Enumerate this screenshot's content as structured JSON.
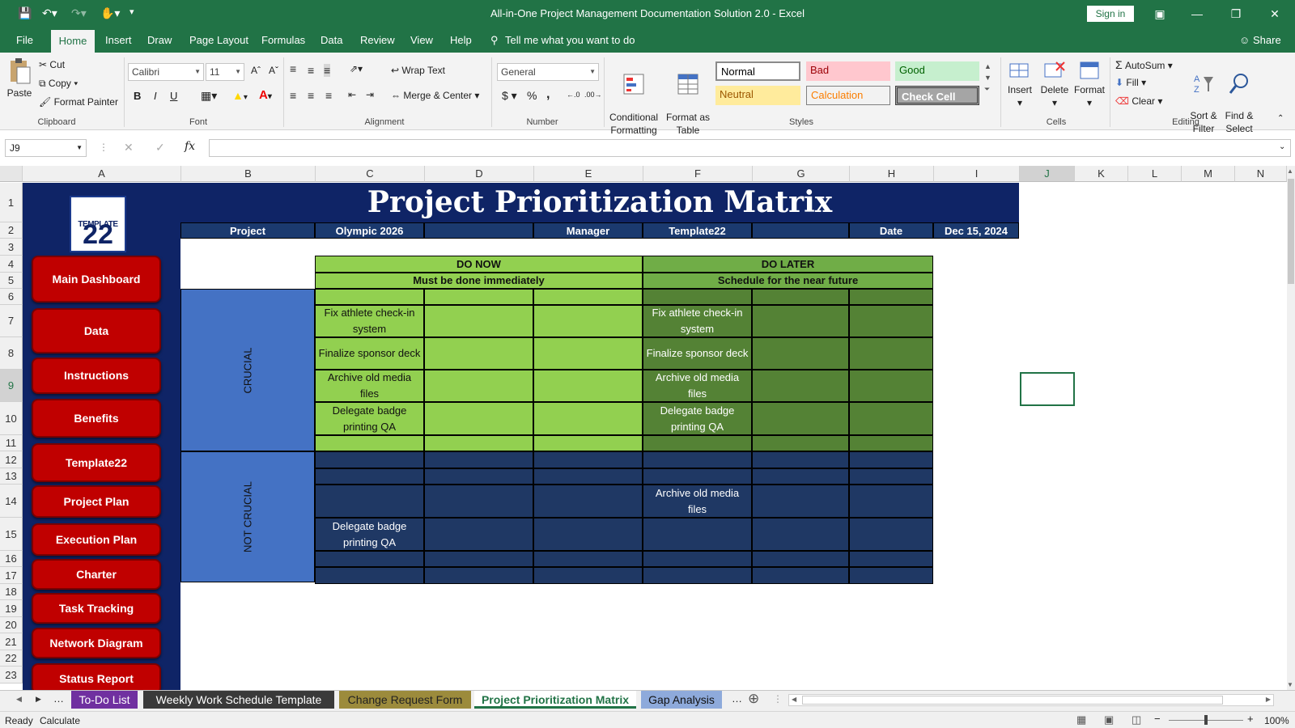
{
  "window": {
    "title": "All-in-One Project Management Documentation Solution 2.0  -  Excel",
    "sign_in": "Sign in",
    "share": "Share"
  },
  "ribbon_tabs": [
    "File",
    "Home",
    "Insert",
    "Draw",
    "Page Layout",
    "Formulas",
    "Data",
    "Review",
    "View",
    "Help"
  ],
  "tell_me": "Tell me what you want to do",
  "clipboard": {
    "paste": "Paste",
    "cut": "Cut",
    "copy": "Copy",
    "format_painter": "Format Painter",
    "label": "Clipboard"
  },
  "font": {
    "name": "Calibri",
    "size": "11",
    "label": "Font",
    "bold": "B",
    "italic": "I",
    "underline": "U"
  },
  "alignment": {
    "wrap_text": "Wrap Text",
    "merge_center": "Merge & Center",
    "label": "Alignment"
  },
  "number": {
    "format": "General",
    "label": "Number",
    "currency": "$",
    "percent": "%",
    "comma": ","
  },
  "styles": {
    "conditional": "Conditional\nFormatting",
    "format_table": "Format as\nTable",
    "label": "Styles",
    "cells": [
      {
        "name": "Normal",
        "bg": "#ffffff",
        "fg": "#000000"
      },
      {
        "name": "Bad",
        "bg": "#ffc7ce",
        "fg": "#9c0006"
      },
      {
        "name": "Good",
        "bg": "#c6efce",
        "fg": "#006100"
      },
      {
        "name": "Neutral",
        "bg": "#ffeb9c",
        "fg": "#9c5700"
      },
      {
        "name": "Calculation",
        "bg": "#f2f2f2",
        "fg": "#fa7d00"
      },
      {
        "name": "Check Cell",
        "bg": "#a5a5a5",
        "fg": "#ffffff"
      }
    ]
  },
  "cells": {
    "insert": "Insert",
    "delete": "Delete",
    "format": "Format",
    "label": "Cells"
  },
  "editing": {
    "autosum": "AutoSum",
    "fill": "Fill",
    "clear": "Clear",
    "sort": "Sort &\nFilter",
    "find": "Find &\nSelect",
    "label": "Editing"
  },
  "namebox": "J9",
  "columns": [
    "A",
    "B",
    "C",
    "D",
    "E",
    "F",
    "G",
    "H",
    "I",
    "J",
    "K",
    "L",
    "M",
    "N"
  ],
  "rows": [
    "1",
    "2",
    "3",
    "4",
    "5",
    "6",
    "7",
    "8",
    "9",
    "10",
    "11",
    "12",
    "13",
    "14",
    "15",
    "16",
    "17",
    "18",
    "19",
    "20",
    "21",
    "22",
    "23"
  ],
  "nav": [
    "Main Dashboard",
    "Data",
    "Instructions",
    "Benefits",
    "Template22",
    "Project Plan",
    "Execution Plan",
    "Charter",
    "Task Tracking",
    "Network Diagram",
    "Status Report"
  ],
  "logo": {
    "top": "TEMPLATE",
    "num": "22"
  },
  "banner": "Project Prioritization Matrix",
  "header": {
    "project_label": "Project",
    "project_value": "Olympic 2026",
    "manager_label": "Manager",
    "manager_value": "Template22",
    "date_label": "Date",
    "date_value": "Dec 15, 2024"
  },
  "matrix": {
    "do_now": "DO NOW",
    "do_now_sub": "Must be done immediately",
    "do_later": "DO LATER",
    "do_later_sub": "Schedule for the near future",
    "crucial": "CRUCIAL",
    "not_crucial": "NOT CRUCIAL",
    "now_crucial": [
      "Fix athlete check-in system",
      "Finalize sponsor deck",
      "Archive old media files",
      "Delegate badge printing QA"
    ],
    "later_crucial": [
      "Fix athlete check-in system",
      "Finalize sponsor deck",
      "Archive old media files",
      "Delegate badge printing QA"
    ],
    "later_not_crucial": "Archive old media files",
    "now_not_crucial": "Delegate badge printing QA"
  },
  "sheet_tabs": [
    {
      "name": "To-Do List",
      "bg": "#7030a0",
      "fg": "#ffffff"
    },
    {
      "name": "Weekly Work Schedule Template",
      "bg": "#3a3a3a",
      "fg": "#ffffff"
    },
    {
      "name": "Change Request Form",
      "bg": "#9c8b3c",
      "fg": "#222222"
    },
    {
      "name": "Project Prioritization Matrix",
      "bg": "#ffffff",
      "fg": "#217346"
    },
    {
      "name": "Gap Analysis",
      "bg": "#8eaadb",
      "fg": "#111111"
    }
  ],
  "status": {
    "ready": "Ready",
    "calculate": "Calculate",
    "zoom": "100%"
  }
}
